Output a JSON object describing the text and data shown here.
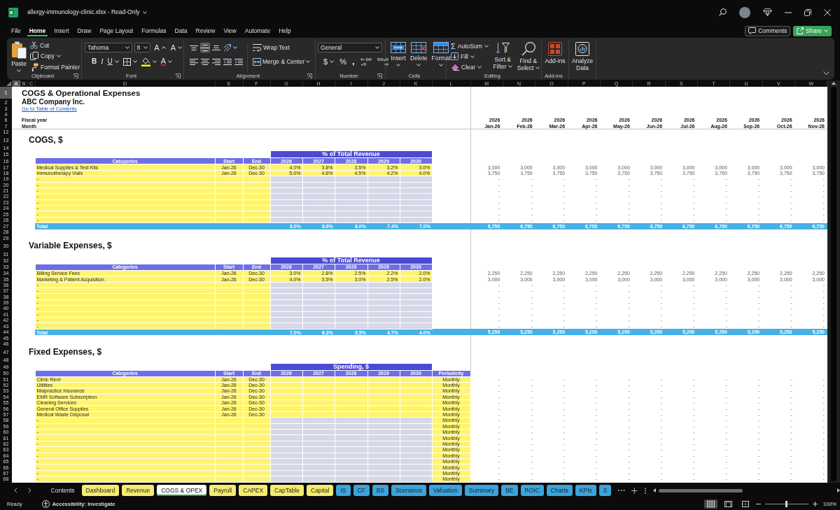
{
  "title_bar": {
    "title": "allergy-immunology-clinic.xlsx - Read-Only"
  },
  "menu": [
    {
      "label": "File",
      "selected": false
    },
    {
      "label": "Home",
      "selected": true
    },
    {
      "label": "Insert",
      "selected": false
    },
    {
      "label": "Draw",
      "selected": false
    },
    {
      "label": "Page Layout",
      "selected": false
    },
    {
      "label": "Formulas",
      "selected": false
    },
    {
      "label": "Data",
      "selected": false
    },
    {
      "label": "Review",
      "selected": false
    },
    {
      "label": "View",
      "selected": false
    },
    {
      "label": "Automate",
      "selected": false
    },
    {
      "label": "Help",
      "selected": false
    }
  ],
  "comments_button": "Comments",
  "share_button": "Share",
  "ribbon": {
    "clipboard": {
      "paste": "Paste",
      "cut": "Cut",
      "copy": "Copy",
      "format_painter": "Format Painter",
      "label": "Clipboard"
    },
    "font": {
      "font_name": "Tahoma",
      "font_size": "8",
      "grow": "A",
      "shrink": "A",
      "bold": "B",
      "italic": "I",
      "underline": "U",
      "font_color": "A",
      "label": "Font"
    },
    "alignment": {
      "vertical": [
        {
          "selected": false
        },
        {
          "selected": true
        },
        {
          "selected": false
        }
      ],
      "horizontal": [
        {
          "selected": false
        },
        {
          "selected": false
        },
        {
          "selected": false
        }
      ],
      "wrap_text": "Wrap Text",
      "merge_center": "Merge & Center",
      "label": "Alignment"
    },
    "number": {
      "format": "General",
      "currency": "$",
      "percent": "%",
      "comma": ",",
      "label": "Number"
    },
    "cells": {
      "insert": "Insert",
      "delete": "Delete",
      "format": "Format",
      "label": "Cells"
    },
    "editing": {
      "autosum_symbol": "Σ",
      "autosum": "AutoSum",
      "fill": "Fill",
      "clear": "Clear",
      "sort_filter": "Sort & Filter",
      "find_select": "Find & Select",
      "label": "Editing"
    },
    "addins": {
      "addins": "Add-ins",
      "label": "Add-ins"
    },
    "analyze": {
      "analyze_data": "Analyze Data"
    }
  },
  "sheet": {
    "columns": [
      {
        "label": "A",
        "selected": true
      },
      {
        "label": "B",
        "selected": false
      },
      {
        "label": "C",
        "selected": false
      },
      {
        "label": "D",
        "selected": false
      },
      {
        "label": "E",
        "selected": false
      },
      {
        "label": "F",
        "selected": false
      },
      {
        "label": "G",
        "selected": false
      },
      {
        "label": "H",
        "selected": false
      },
      {
        "label": "I",
        "selected": false
      },
      {
        "label": "J",
        "selected": false
      },
      {
        "label": "K",
        "selected": false
      },
      {
        "label": "L",
        "selected": false
      },
      {
        "label": "M",
        "selected": false
      },
      {
        "label": "N",
        "selected": false
      },
      {
        "label": "O",
        "selected": false
      },
      {
        "label": "P",
        "selected": false
      },
      {
        "label": "Q",
        "selected": false
      },
      {
        "label": "R",
        "selected": false
      },
      {
        "label": "S",
        "selected": false
      },
      {
        "label": "T",
        "selected": false
      },
      {
        "label": "U",
        "selected": false
      },
      {
        "label": "V",
        "selected": false
      },
      {
        "label": "W",
        "selected": false
      }
    ],
    "rows": [
      {
        "number": "1",
        "selected": true,
        "kind": "title",
        "text": "COGS & Operational Expenses"
      },
      {
        "number": "2",
        "selected": false,
        "kind": "subtitle",
        "text": "ABC Company Inc."
      },
      {
        "number": "3",
        "selected": false,
        "kind": "link",
        "text": "Go to Table of Contents"
      },
      {
        "number": "4",
        "selected": false,
        "kind": "blank"
      },
      {
        "number": "6",
        "selected": false,
        "kind": "timeline",
        "label": "Fiscal year",
        "months": [
          "2026",
          "2026",
          "2026",
          "2026",
          "2026",
          "2026",
          "2026",
          "2026",
          "2026",
          "2026",
          "2026"
        ]
      },
      {
        "number": "7",
        "selected": false,
        "kind": "timeline",
        "label": "Month",
        "months": [
          "Jan-26",
          "Feb-26",
          "Mar-26",
          "Apr-26",
          "May-26",
          "Jun-26",
          "Jul-26",
          "Aug-26",
          "Sep-26",
          "Oct-26",
          "Nov-26"
        ]
      },
      {
        "number": "12",
        "selected": false,
        "kind": "blank"
      },
      {
        "number": "13",
        "selected": false,
        "kind": "section",
        "text": "COGS, $"
      },
      {
        "number": "14",
        "selected": false,
        "kind": "blank"
      },
      {
        "number": "15",
        "selected": false,
        "kind": "band",
        "text": "% of Total Revenue"
      },
      {
        "number": "16",
        "selected": false,
        "kind": "header",
        "cells": [
          "Categories",
          "Start",
          "End",
          "2026",
          "2027",
          "2028",
          "2029",
          "2030"
        ]
      },
      {
        "number": "17",
        "selected": false,
        "kind": "data",
        "disabled": false,
        "category": "Medical Supplies & Test Kits",
        "start": "Jan-26",
        "end": "Dec-30",
        "years": [
          "4.0%",
          "3.8%",
          "3.5%",
          "3.2%",
          "3.0%"
        ],
        "months": [
          "3,000",
          "3,000",
          "3,000",
          "3,000",
          "3,000",
          "3,000",
          "3,000",
          "3,000",
          "3,000",
          "3,000",
          "3,000"
        ]
      },
      {
        "number": "18",
        "selected": false,
        "kind": "data",
        "disabled": false,
        "category": "Immunotherapy Vials",
        "start": "Jan-26",
        "end": "Dec-30",
        "years": [
          "5.0%",
          "4.8%",
          "4.5%",
          "4.2%",
          "4.0%"
        ],
        "months": [
          "3,750",
          "3,750",
          "3,750",
          "3,750",
          "3,750",
          "3,750",
          "3,750",
          "3,750",
          "3,750",
          "3,750",
          "3,750"
        ]
      },
      {
        "number": "19",
        "selected": false,
        "kind": "data",
        "disabled": true,
        "category": "-",
        "months": [
          "-",
          "-",
          "-",
          "-",
          "-",
          "-",
          "-",
          "-",
          "-",
          "-",
          "-"
        ]
      },
      {
        "number": "20",
        "selected": false,
        "kind": "data",
        "disabled": true,
        "category": "-",
        "months": [
          "-",
          "-",
          "-",
          "-",
          "-",
          "-",
          "-",
          "-",
          "-",
          "-",
          "-"
        ]
      },
      {
        "number": "21",
        "selected": false,
        "kind": "data",
        "disabled": true,
        "category": "-",
        "months": [
          "-",
          "-",
          "-",
          "-",
          "-",
          "-",
          "-",
          "-",
          "-",
          "-",
          "-"
        ]
      },
      {
        "number": "22",
        "selected": false,
        "kind": "data",
        "disabled": true,
        "category": "-",
        "months": [
          "-",
          "-",
          "-",
          "-",
          "-",
          "-",
          "-",
          "-",
          "-",
          "-",
          "-"
        ]
      },
      {
        "number": "23",
        "selected": false,
        "kind": "data",
        "disabled": true,
        "category": "-",
        "months": [
          "-",
          "-",
          "-",
          "-",
          "-",
          "-",
          "-",
          "-",
          "-",
          "-",
          "-"
        ]
      },
      {
        "number": "24",
        "selected": false,
        "kind": "data",
        "disabled": true,
        "category": "-",
        "months": [
          "-",
          "-",
          "-",
          "-",
          "-",
          "-",
          "-",
          "-",
          "-",
          "-",
          "-"
        ]
      },
      {
        "number": "25",
        "selected": false,
        "kind": "data",
        "disabled": true,
        "category": "-",
        "months": [
          "-",
          "-",
          "-",
          "-",
          "-",
          "-",
          "-",
          "-",
          "-",
          "-",
          "-"
        ]
      },
      {
        "number": "26",
        "selected": false,
        "kind": "data",
        "disabled": true,
        "category": "-",
        "months": [
          "-",
          "-",
          "-",
          "-",
          "-",
          "-",
          "-",
          "-",
          "-",
          "-",
          "-"
        ]
      },
      {
        "number": "27",
        "selected": false,
        "kind": "total",
        "label": "Total",
        "years": [
          "9.0%",
          "8.6%",
          "8.0%",
          "7.4%",
          "7.0%"
        ],
        "months": [
          "6,750",
          "6,750",
          "6,750",
          "6,750",
          "6,750",
          "6,750",
          "6,750",
          "6,750",
          "6,750",
          "6,750",
          "6,750"
        ]
      },
      {
        "number": "28",
        "selected": false,
        "kind": "blank"
      },
      {
        "number": "29",
        "selected": false,
        "kind": "blank"
      },
      {
        "number": "30",
        "selected": false,
        "kind": "section",
        "text": "Variable Expenses, $"
      },
      {
        "number": "31",
        "selected": false,
        "kind": "blank"
      },
      {
        "number": "32",
        "selected": false,
        "kind": "band",
        "text": "% of Total Revenue"
      },
      {
        "number": "33",
        "selected": false,
        "kind": "header",
        "cells": [
          "Categories",
          "Start",
          "End",
          "2026",
          "2027",
          "2028",
          "2029",
          "2030"
        ]
      },
      {
        "number": "34",
        "selected": false,
        "kind": "data",
        "disabled": false,
        "category": "Billing Service Fees",
        "start": "Jan-26",
        "end": "Dec-30",
        "years": [
          "3.0%",
          "2.8%",
          "2.5%",
          "2.2%",
          "2.0%"
        ],
        "months": [
          "2,250",
          "2,250",
          "2,250",
          "2,250",
          "2,250",
          "2,250",
          "2,250",
          "2,250",
          "2,250",
          "2,250",
          "2,250"
        ]
      },
      {
        "number": "35",
        "selected": false,
        "kind": "data",
        "disabled": false,
        "category": "Marketing & Patient Acquisition",
        "start": "Jan-26",
        "end": "Dec-30",
        "years": [
          "4.0%",
          "3.5%",
          "3.0%",
          "2.5%",
          "2.0%"
        ],
        "months": [
          "3,000",
          "3,000",
          "3,000",
          "3,000",
          "3,000",
          "3,000",
          "3,000",
          "3,000",
          "3,000",
          "3,000",
          "3,000"
        ]
      },
      {
        "number": "36",
        "selected": false,
        "kind": "data",
        "disabled": true,
        "category": "-",
        "months": [
          "-",
          "-",
          "-",
          "-",
          "-",
          "-",
          "-",
          "-",
          "-",
          "-",
          "-"
        ]
      },
      {
        "number": "37",
        "selected": false,
        "kind": "data",
        "disabled": true,
        "category": "-",
        "months": [
          "-",
          "-",
          "-",
          "-",
          "-",
          "-",
          "-",
          "-",
          "-",
          "-",
          "-"
        ]
      },
      {
        "number": "38",
        "selected": false,
        "kind": "data",
        "disabled": true,
        "category": "-",
        "months": [
          "-",
          "-",
          "-",
          "-",
          "-",
          "-",
          "-",
          "-",
          "-",
          "-",
          "-"
        ]
      },
      {
        "number": "39",
        "selected": false,
        "kind": "data",
        "disabled": true,
        "category": "-",
        "months": [
          "-",
          "-",
          "-",
          "-",
          "-",
          "-",
          "-",
          "-",
          "-",
          "-",
          "-"
        ]
      },
      {
        "number": "40",
        "selected": false,
        "kind": "data",
        "disabled": true,
        "category": "-",
        "months": [
          "-",
          "-",
          "-",
          "-",
          "-",
          "-",
          "-",
          "-",
          "-",
          "-",
          "-"
        ]
      },
      {
        "number": "41",
        "selected": false,
        "kind": "data",
        "disabled": true,
        "category": "-",
        "months": [
          "-",
          "-",
          "-",
          "-",
          "-",
          "-",
          "-",
          "-",
          "-",
          "-",
          "-"
        ]
      },
      {
        "number": "42",
        "selected": false,
        "kind": "data",
        "disabled": true,
        "category": "-",
        "months": [
          "-",
          "-",
          "-",
          "-",
          "-",
          "-",
          "-",
          "-",
          "-",
          "-",
          "-"
        ]
      },
      {
        "number": "43",
        "selected": false,
        "kind": "data",
        "disabled": true,
        "category": "-",
        "months": [
          "-",
          "-",
          "-",
          "-",
          "-",
          "-",
          "-",
          "-",
          "-",
          "-",
          "-"
        ]
      },
      {
        "number": "44",
        "selected": false,
        "kind": "total",
        "label": "Total",
        "years": [
          "7.0%",
          "6.3%",
          "5.5%",
          "4.7%",
          "4.0%"
        ],
        "months": [
          "5,250",
          "5,250",
          "5,250",
          "5,250",
          "5,250",
          "5,250",
          "5,250",
          "5,250",
          "5,250",
          "5,250",
          "5,250"
        ]
      },
      {
        "number": "45",
        "selected": false,
        "kind": "blank"
      },
      {
        "number": "46",
        "selected": false,
        "kind": "blank"
      },
      {
        "number": "47",
        "selected": false,
        "kind": "section",
        "text": "Fixed Expenses, $"
      },
      {
        "number": "48",
        "selected": false,
        "kind": "blank"
      },
      {
        "number": "49",
        "selected": false,
        "kind": "band",
        "text": "Spending, $"
      },
      {
        "number": "50",
        "selected": false,
        "kind": "header",
        "cells": [
          "Categories",
          "Start",
          "End",
          "2026",
          "2027",
          "2028",
          "2029",
          "2030",
          "Periodicity"
        ]
      },
      {
        "number": "51",
        "selected": false,
        "kind": "data",
        "disabled": false,
        "category": "Clinic Rent",
        "start": "Jan-26",
        "end": "Dec-30",
        "periodicity": "Monthly",
        "months": [
          "-",
          "-",
          "-",
          "-",
          "-",
          "-",
          "-",
          "-",
          "-",
          "-",
          "-"
        ]
      },
      {
        "number": "52",
        "selected": false,
        "kind": "data",
        "disabled": false,
        "category": "Utilities",
        "start": "Jan-26",
        "end": "Dec-30",
        "periodicity": "Monthly",
        "months": [
          "-",
          "-",
          "-",
          "-",
          "-",
          "-",
          "-",
          "-",
          "-",
          "-",
          "-"
        ]
      },
      {
        "number": "53",
        "selected": false,
        "kind": "data",
        "disabled": false,
        "category": "Malpractice Insurance",
        "start": "Jan-26",
        "end": "Dec-30",
        "periodicity": "Monthly",
        "months": [
          "-",
          "-",
          "-",
          "-",
          "-",
          "-",
          "-",
          "-",
          "-",
          "-",
          "-"
        ]
      },
      {
        "number": "54",
        "selected": false,
        "kind": "data",
        "disabled": false,
        "category": "EMR Software Subscription",
        "start": "Jan-26",
        "end": "Dec-30",
        "periodicity": "Monthly",
        "months": [
          "-",
          "-",
          "-",
          "-",
          "-",
          "-",
          "-",
          "-",
          "-",
          "-",
          "-"
        ]
      },
      {
        "number": "55",
        "selected": false,
        "kind": "data",
        "disabled": false,
        "category": "Cleaning Services",
        "start": "Jan-26",
        "end": "Dec-30",
        "periodicity": "Monthly",
        "months": [
          "-",
          "-",
          "-",
          "-",
          "-",
          "-",
          "-",
          "-",
          "-",
          "-",
          "-"
        ]
      },
      {
        "number": "56",
        "selected": false,
        "kind": "data",
        "disabled": false,
        "category": "General Office Supplies",
        "start": "Jan-26",
        "end": "Dec-30",
        "periodicity": "Monthly",
        "months": [
          "-",
          "-",
          "-",
          "-",
          "-",
          "-",
          "-",
          "-",
          "-",
          "-",
          "-"
        ]
      },
      {
        "number": "57",
        "selected": false,
        "kind": "data",
        "disabled": false,
        "category": "Medical Waste Disposal",
        "start": "Jan-26",
        "end": "Dec-30",
        "periodicity": "Monthly",
        "months": [
          "-",
          "-",
          "-",
          "-",
          "-",
          "-",
          "-",
          "-",
          "-",
          "-",
          "-"
        ]
      },
      {
        "number": "58",
        "selected": false,
        "kind": "data",
        "disabled": true,
        "category": "-",
        "periodicity": "Monthly",
        "months": [
          "-",
          "-",
          "-",
          "-",
          "-",
          "-",
          "-",
          "-",
          "-",
          "-",
          "-"
        ]
      },
      {
        "number": "59",
        "selected": false,
        "kind": "data",
        "disabled": true,
        "category": "-",
        "periodicity": "Monthly",
        "months": [
          "-",
          "-",
          "-",
          "-",
          "-",
          "-",
          "-",
          "-",
          "-",
          "-",
          "-"
        ]
      },
      {
        "number": "60",
        "selected": false,
        "kind": "data",
        "disabled": true,
        "category": "-",
        "periodicity": "Monthly",
        "months": [
          "-",
          "-",
          "-",
          "-",
          "-",
          "-",
          "-",
          "-",
          "-",
          "-",
          "-"
        ]
      },
      {
        "number": "61",
        "selected": false,
        "kind": "data",
        "disabled": true,
        "category": "-",
        "periodicity": "Monthly",
        "months": [
          "-",
          "-",
          "-",
          "-",
          "-",
          "-",
          "-",
          "-",
          "-",
          "-",
          "-"
        ]
      },
      {
        "number": "62",
        "selected": false,
        "kind": "data",
        "disabled": true,
        "category": "-",
        "periodicity": "Monthly",
        "months": [
          "-",
          "-",
          "-",
          "-",
          "-",
          "-",
          "-",
          "-",
          "-",
          "-",
          "-"
        ]
      },
      {
        "number": "63",
        "selected": false,
        "kind": "data",
        "disabled": true,
        "category": "-",
        "periodicity": "Monthly",
        "months": [
          "-",
          "-",
          "-",
          "-",
          "-",
          "-",
          "-",
          "-",
          "-",
          "-",
          "-"
        ]
      },
      {
        "number": "64",
        "selected": false,
        "kind": "data",
        "disabled": true,
        "category": "-",
        "periodicity": "Monthly",
        "months": [
          "-",
          "-",
          "-",
          "-",
          "-",
          "-",
          "-",
          "-",
          "-",
          "-",
          "-"
        ]
      },
      {
        "number": "65",
        "selected": false,
        "kind": "data",
        "disabled": true,
        "category": "-",
        "periodicity": "Monthly",
        "months": [
          "-",
          "-",
          "-",
          "-",
          "-",
          "-",
          "-",
          "-",
          "-",
          "-",
          "-"
        ]
      },
      {
        "number": "66",
        "selected": false,
        "kind": "data",
        "disabled": true,
        "category": "-",
        "periodicity": "Monthly",
        "months": [
          "-",
          "-",
          "-",
          "-",
          "-",
          "-",
          "-",
          "-",
          "-",
          "-",
          "-"
        ]
      },
      {
        "number": "67",
        "selected": false,
        "kind": "data",
        "disabled": true,
        "category": "-",
        "periodicity": "Monthly",
        "months": [
          "-",
          "-",
          "-",
          "-",
          "-",
          "-",
          "-",
          "-",
          "-",
          "-",
          "-"
        ]
      },
      {
        "number": "68",
        "selected": false,
        "kind": "data",
        "disabled": true,
        "category": "-",
        "periodicity": "Monthly",
        "months": [
          "-",
          "-",
          "-",
          "-",
          "-",
          "-",
          "-",
          "-",
          "-",
          "-",
          "-"
        ]
      }
    ]
  },
  "sheet_tabs": [
    {
      "label": "Contents",
      "selected": false
    },
    {
      "label": "Dashboard",
      "selected": false,
      "color": "#f5ec6e"
    },
    {
      "label": "Revenue",
      "selected": false,
      "color": "#f5ec6e"
    },
    {
      "label": "COGS & OPEX",
      "selected": true
    },
    {
      "label": "Payroll",
      "selected": false,
      "color": "#f5ec6e"
    },
    {
      "label": "CAPEX",
      "selected": false,
      "color": "#f5ec6e"
    },
    {
      "label": "CapTable",
      "selected": false,
      "color": "#f5ec6e"
    },
    {
      "label": "Capital",
      "selected": false,
      "color": "#f5ec6e"
    },
    {
      "label": "IS",
      "selected": false,
      "color": "#3aa4dd"
    },
    {
      "label": "CF",
      "selected": false,
      "color": "#3aa4dd"
    },
    {
      "label": "BS",
      "selected": false,
      "color": "#3aa4dd"
    },
    {
      "label": "Scenarios",
      "selected": false,
      "color": "#3aa4dd"
    },
    {
      "label": "Valuation",
      "selected": false,
      "color": "#3aa4dd"
    },
    {
      "label": "Summary",
      "selected": false,
      "color": "#3aa4dd"
    },
    {
      "label": "BE",
      "selected": false,
      "color": "#3aa4dd"
    },
    {
      "label": "ROIC",
      "selected": false,
      "color": "#3aa4dd"
    },
    {
      "label": "Charts",
      "selected": false,
      "color": "#3aa4dd"
    },
    {
      "label": "KPIs",
      "selected": false,
      "color": "#3aa4dd"
    },
    {
      "label": "S",
      "selected": false,
      "color": "#3aa4dd"
    }
  ],
  "status_bar": {
    "status": "Ready",
    "accessibility": "Accessibility: Investigate",
    "views": [
      {
        "selected": true
      },
      {
        "selected": false
      },
      {
        "selected": false
      }
    ],
    "zoom": {
      "level": 0.5,
      "reading": "100%"
    }
  }
}
